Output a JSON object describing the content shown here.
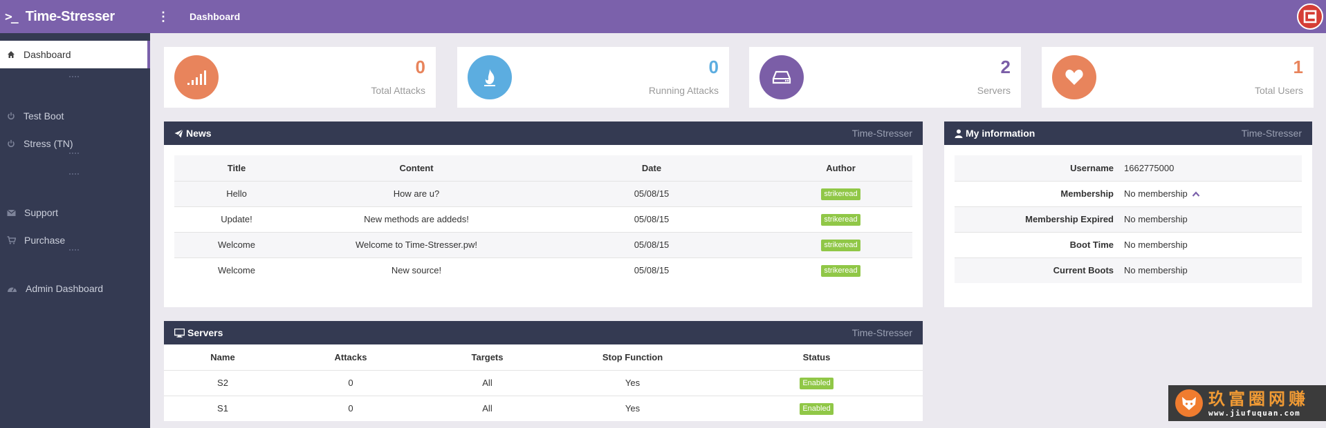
{
  "app": {
    "title": "Time-Stresser",
    "brand_icon": ">_"
  },
  "header": {
    "breadcrumb": "Dashboard",
    "menu_icon": "kebab-icon",
    "avatar_icon": "logo-icon"
  },
  "colors": {
    "accent": "#7b61ab",
    "sidebar": "#343a52",
    "orange": "#e8845c",
    "blue": "#5cade0",
    "purple": "#7b5ea7",
    "green": "#90c747"
  },
  "sidebar": {
    "items": [
      {
        "label": "Dashboard",
        "icon": "home-icon",
        "active": true
      },
      {
        "label": "Test Boot",
        "icon": "power-icon"
      },
      {
        "label": "Stress (TN)",
        "icon": "power-icon"
      },
      {
        "label": "Support",
        "icon": "envelope-icon"
      },
      {
        "label": "Purchase",
        "icon": "cart-icon"
      },
      {
        "label": "Admin Dashboard",
        "icon": "dashboard-icon"
      }
    ]
  },
  "stats": [
    {
      "value": "0",
      "label": "Total Attacks",
      "icon": "signal-icon",
      "color": "#e8845c"
    },
    {
      "value": "0",
      "label": "Running Attacks",
      "icon": "fire-icon",
      "color": "#5cade0"
    },
    {
      "value": "2",
      "label": "Servers",
      "icon": "harddrive-icon",
      "color": "#7b5ea7"
    },
    {
      "value": "1",
      "label": "Total Users",
      "icon": "heart-icon",
      "color": "#e8845c"
    }
  ],
  "news": {
    "title": "News",
    "subtitle": "Time-Stresser",
    "columns": [
      "Title",
      "Content",
      "Date",
      "Author"
    ],
    "rows": [
      {
        "title": "Hello",
        "content": "How are u?",
        "date": "05/08/15",
        "author": "strikeread"
      },
      {
        "title": "Update!",
        "content": "New methods are addeds!",
        "date": "05/08/15",
        "author": "strikeread"
      },
      {
        "title": "Welcome",
        "content": "Welcome to Time-Stresser.pw!",
        "date": "05/08/15",
        "author": "strikeread"
      },
      {
        "title": "Welcome",
        "content": "New source!",
        "date": "05/08/15",
        "author": "strikeread"
      }
    ]
  },
  "info": {
    "title": "My information",
    "subtitle": "Time-Stresser",
    "rows": [
      {
        "key": "Username",
        "value": "1662775000"
      },
      {
        "key": "Membership",
        "value": "No membership"
      },
      {
        "key": "Membership Expired",
        "value": "No membership"
      },
      {
        "key": "Boot Time",
        "value": "No membership"
      },
      {
        "key": "Current Boots",
        "value": "No membership"
      }
    ]
  },
  "servers": {
    "title": "Servers",
    "subtitle": "Time-Stresser",
    "columns": [
      "Name",
      "Attacks",
      "Targets",
      "Stop Function",
      "Status"
    ],
    "rows": [
      {
        "name": "S2",
        "attacks": "0",
        "targets": "All",
        "stop": "Yes",
        "status": "Enabled"
      },
      {
        "name": "S1",
        "attacks": "0",
        "targets": "All",
        "stop": "Yes",
        "status": "Enabled"
      }
    ]
  },
  "watermark": {
    "title": "玖富圈网赚",
    "url": "www.jiufuquan.com"
  }
}
